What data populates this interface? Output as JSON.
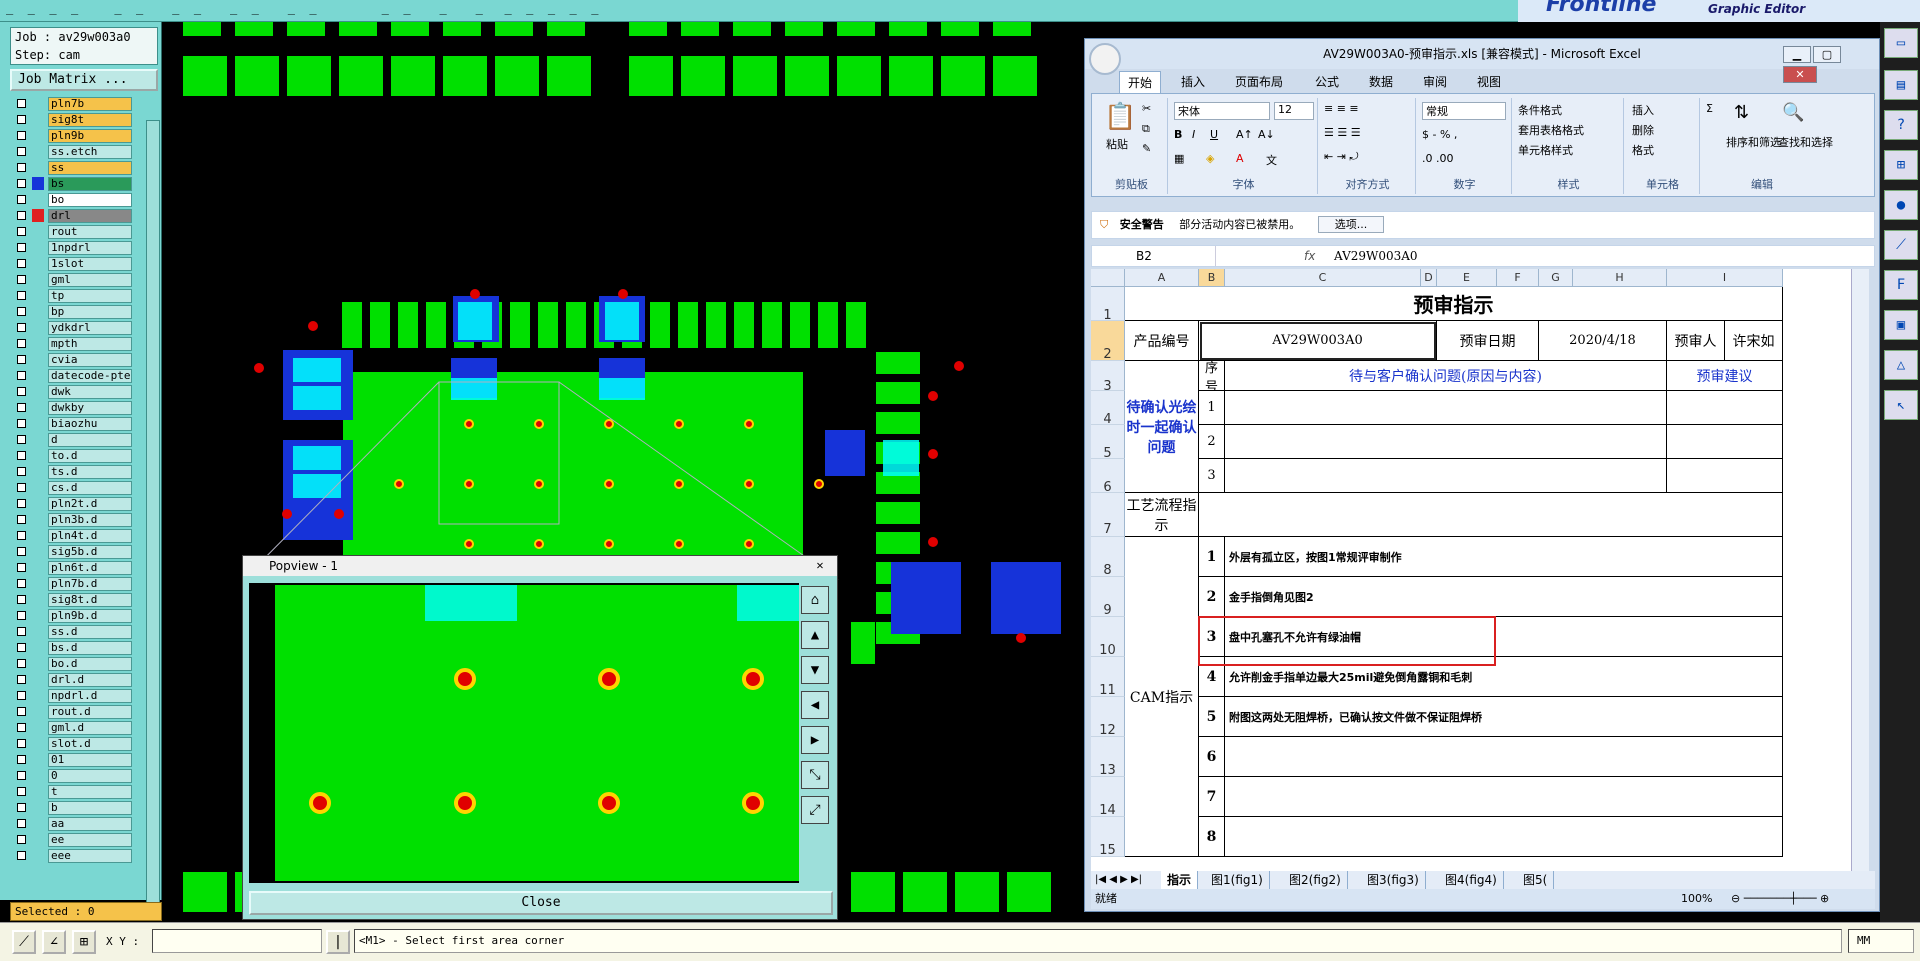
{
  "topbar": {
    "menu": "_  _  _  _     _  _    _  _    _  _    _  _         _  _    _    _   _  _  _  _  _"
  },
  "brand": {
    "name": "Frontline",
    "subtitle": "Graphic Editor"
  },
  "left_panel": {
    "job": "Job : av29w003a0",
    "step": "Step: cam",
    "job_matrix": "Job Matrix ...",
    "layers": [
      {
        "name": "pln7b",
        "color": "#f5c24a"
      },
      {
        "name": "sig8t",
        "color": "#f5c24a"
      },
      {
        "name": "pln9b",
        "color": "#f5c24a"
      },
      {
        "name": "ss.etch",
        "color": "#bde8e5"
      },
      {
        "name": "ss",
        "color": "#f5c24a"
      },
      {
        "name": "bs",
        "color": "#2a9a5a",
        "sw": "#1633d9"
      },
      {
        "name": "bo",
        "color": "#ffffff"
      },
      {
        "name": "drl",
        "color": "#888888",
        "sw": "#e02020"
      },
      {
        "name": "rout",
        "color": "#bde8e5"
      },
      {
        "name": "1npdrl",
        "color": "#bde8e5"
      },
      {
        "name": "1slot",
        "color": "#bde8e5"
      },
      {
        "name": "gml",
        "color": "#bde8e5"
      },
      {
        "name": "tp",
        "color": "#bde8e5"
      },
      {
        "name": "bp",
        "color": "#bde8e5"
      },
      {
        "name": "ydkdrl",
        "color": "#bde8e5"
      },
      {
        "name": "mpth",
        "color": "#bde8e5"
      },
      {
        "name": "cvia",
        "color": "#bde8e5"
      },
      {
        "name": "datecode-pte",
        "color": "#bde8e5"
      },
      {
        "name": "dwk",
        "color": "#bde8e5"
      },
      {
        "name": "dwkby",
        "color": "#bde8e5"
      },
      {
        "name": "biaozhu",
        "color": "#bde8e5"
      },
      {
        "name": "d",
        "color": "#bde8e5"
      },
      {
        "name": "to.d",
        "color": "#bde8e5"
      },
      {
        "name": "ts.d",
        "color": "#bde8e5"
      },
      {
        "name": "cs.d",
        "color": "#bde8e5"
      },
      {
        "name": "pln2t.d",
        "color": "#bde8e5"
      },
      {
        "name": "pln3b.d",
        "color": "#bde8e5"
      },
      {
        "name": "pln4t.d",
        "color": "#bde8e5"
      },
      {
        "name": "sig5b.d",
        "color": "#bde8e5"
      },
      {
        "name": "pln6t.d",
        "color": "#bde8e5"
      },
      {
        "name": "pln7b.d",
        "color": "#bde8e5"
      },
      {
        "name": "sig8t.d",
        "color": "#bde8e5"
      },
      {
        "name": "pln9b.d",
        "color": "#bde8e5"
      },
      {
        "name": "ss.d",
        "color": "#bde8e5"
      },
      {
        "name": "bs.d",
        "color": "#bde8e5"
      },
      {
        "name": "bo.d",
        "color": "#bde8e5"
      },
      {
        "name": "drl.d",
        "color": "#bde8e5"
      },
      {
        "name": "npdrl.d",
        "color": "#bde8e5"
      },
      {
        "name": "rout.d",
        "color": "#bde8e5"
      },
      {
        "name": "gml.d",
        "color": "#bde8e5"
      },
      {
        "name": "slot.d",
        "color": "#bde8e5"
      },
      {
        "name": "01",
        "color": "#bde8e5"
      },
      {
        "name": "0",
        "color": "#bde8e5"
      },
      {
        "name": "t",
        "color": "#bde8e5"
      },
      {
        "name": "b",
        "color": "#bde8e5"
      },
      {
        "name": "aa",
        "color": "#bde8e5"
      },
      {
        "name": "ee",
        "color": "#bde8e5"
      },
      {
        "name": "eee",
        "color": "#bde8e5"
      }
    ],
    "selected": "Selected : 0"
  },
  "bottom": {
    "xy_label": "X Y :",
    "xy_value": "",
    "message": "<M1> - Select first area corner",
    "units": "MM"
  },
  "popview": {
    "title": "Popview - 1",
    "close_x": "✕",
    "close_button": "Close"
  },
  "excel": {
    "title": "AV29W003A0-预审指示.xls  [兼容模式]  -  Microsoft Excel",
    "tabs": [
      "开始",
      "插入",
      "页面布局",
      "公式",
      "数据",
      "审阅",
      "视图"
    ],
    "ribbon": {
      "paste": "粘贴",
      "clipboard": "剪贴板",
      "font_name": "宋体",
      "font_size": "12",
      "font": "字体",
      "align": "对齐方式",
      "num_format": "常规",
      "number": "数字",
      "cond_fmt": "条件格式",
      "table_fmt": "套用表格格式",
      "cell_style": "单元格样式",
      "style": "样式",
      "insert": "插入",
      "delete": "删除",
      "format": "格式",
      "cells": "单元格",
      "sort": "排序和筛选",
      "find": "查找和选择",
      "editing": "编辑"
    },
    "security": {
      "label": "安全警告",
      "text": "部分活动内容已被禁用。",
      "button": "选项..."
    },
    "namebox": "B2",
    "fx": "fx",
    "formula": "AV29W003A0",
    "cols": [
      "A",
      "B",
      "C",
      "D",
      "E",
      "F",
      "G",
      "H",
      "I"
    ],
    "rows": [
      "1",
      "2",
      "3",
      "4",
      "5",
      "6",
      "7",
      "8",
      "9",
      "10",
      "11",
      "12",
      "13",
      "14",
      "15"
    ],
    "sheet": {
      "title": "预审指示",
      "product_no_label": "产品编号",
      "product_no": "AV29W003A0",
      "date_label": "预审日期",
      "date": "2020/4/18",
      "reviewer_label": "预审人",
      "reviewer": "许宋如",
      "seq_label": "序号",
      "issue_label": "待与客户确认问题(原因与内容)",
      "suggest_label": "预审建议",
      "confirm_label": "待确认光绘时一起确认问题",
      "process_label": "工艺流程指示",
      "cam_label": "CAM指示",
      "q_nums": [
        "1",
        "2",
        "3"
      ],
      "cam_items": [
        {
          "n": "1",
          "text": "外层有孤立区，按图1常规评审制作"
        },
        {
          "n": "2",
          "text": "金手指倒角见图2"
        },
        {
          "n": "3",
          "text": "盘中孔塞孔不允许有绿油帽"
        },
        {
          "n": "4",
          "text": "允许削金手指单边最大25mil避免倒角露铜和毛刺"
        },
        {
          "n": "5",
          "text": "附图这两处无阻焊桥，已确认按文件做不保证阻焊桥"
        },
        {
          "n": "6",
          "text": ""
        },
        {
          "n": "7",
          "text": ""
        },
        {
          "n": "8",
          "text": ""
        }
      ]
    },
    "sheet_tabs": [
      "指示",
      "图1(fig1)",
      "图2(fig2)",
      "图3(fig3)",
      "图4(fig4)",
      "图5("
    ],
    "status": "就绪",
    "zoom": "100%"
  }
}
